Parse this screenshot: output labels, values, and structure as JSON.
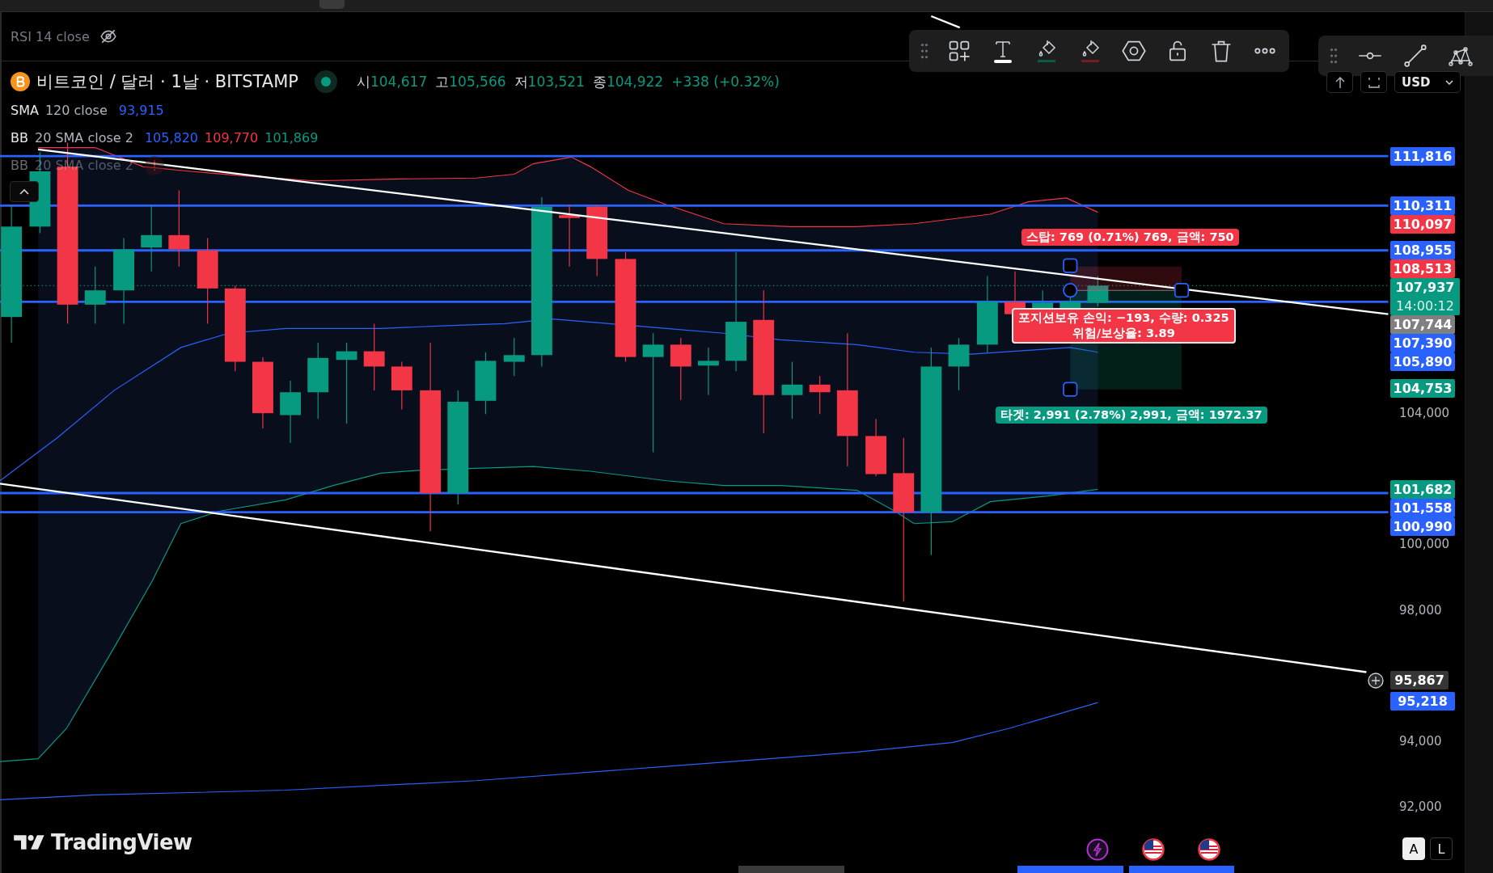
{
  "rsi_pane": {
    "title": "RSI 14 close",
    "hidden": true
  },
  "symbol": {
    "name": "비트코인 / 달러 · 1날 · BITSTAMP",
    "market_open": true,
    "ohlc": [
      {
        "label": "시",
        "value": "104,617"
      },
      {
        "label": "고",
        "value": "105,566"
      },
      {
        "label": "저",
        "value": "103,521"
      },
      {
        "label": "종",
        "value": "104,922"
      }
    ],
    "change": "+338 (+0.32%)"
  },
  "indicators": [
    {
      "name": "SMA",
      "params": "120 close",
      "error": false,
      "faded": false,
      "values": [
        {
          "text": "93,915",
          "color": "#2962ff"
        }
      ]
    },
    {
      "name": "BB",
      "params": "20 SMA close 2",
      "error": false,
      "faded": false,
      "values": [
        {
          "text": "105,820",
          "color": "#2962ff"
        },
        {
          "text": "109,770",
          "color": "#f23645"
        },
        {
          "text": "101,869",
          "color": "#089981"
        }
      ]
    },
    {
      "name": "BB",
      "params": "20 SMA close 2",
      "error": true,
      "faded": true
    }
  ],
  "position_tool": {
    "stop": "스탑: 769 (0.71%) 769, 금액: 750",
    "pnl": "포지션보유 손익: −193, 수량: 0.325",
    "ratio": "위험/보상율: 3.89",
    "target": "타겟: 2,991 (2.78%) 2,991, 금액: 1972.37"
  },
  "currency": "USD",
  "price_axis": {
    "ticks": [
      "104,000",
      "100,000",
      "98,000",
      "94,000",
      "92,000"
    ],
    "labels": [
      {
        "text": "111,816",
        "color": "#2962ff"
      },
      {
        "text": "110,311",
        "color": "#2962ff"
      },
      {
        "text": "110,097",
        "color": "#f23645"
      },
      {
        "text": "108,955",
        "color": "#2962ff"
      },
      {
        "text": "108,513",
        "color": "#f23645"
      },
      {
        "text": "107,937",
        "color": "#089981",
        "countdown": "14:00:12"
      },
      {
        "text": "107,744",
        "color": "#808080"
      },
      {
        "text": "107,390",
        "color": "#2962ff"
      },
      {
        "text": "105,890",
        "color": "#2962ff"
      },
      {
        "text": "104,753",
        "color": "#089981"
      },
      {
        "text": "101,682",
        "color": "#089981"
      },
      {
        "text": "101,558",
        "color": "#2962ff"
      },
      {
        "text": "100,990",
        "color": "#2962ff"
      },
      {
        "text": "95,867",
        "color": "#363636",
        "crosshair": true
      },
      {
        "text": "95,218",
        "color": "#2962ff"
      }
    ]
  },
  "scale_buttons": [
    {
      "label": "A",
      "selected": true
    },
    {
      "label": "L",
      "selected": false
    }
  ],
  "brand": "TradingView"
}
